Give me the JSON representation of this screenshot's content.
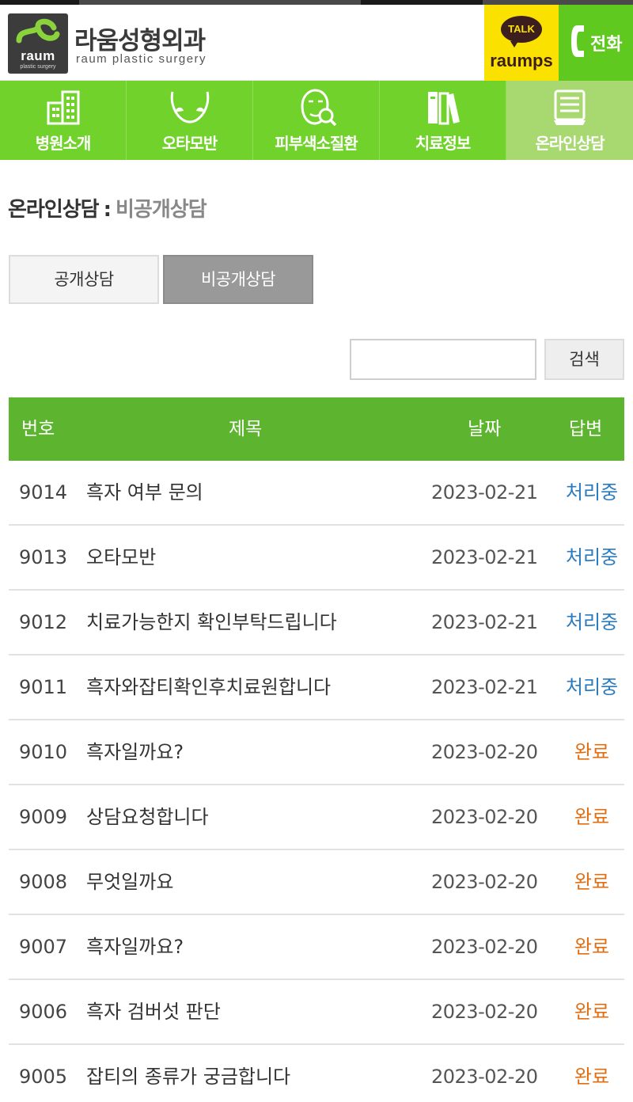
{
  "logo": {
    "mark_word": "raum",
    "mark_sub": "plastic surgery",
    "title_ko": "라움성형외과",
    "title_en": "raum plastic surgery"
  },
  "header_buttons": {
    "kakao_badge": "TALK",
    "kakao_label": "raumps",
    "phone_label": "전화"
  },
  "nav": [
    {
      "label": "병원소개",
      "icon": "building-icon"
    },
    {
      "label": "오타모반",
      "icon": "face-outline-icon"
    },
    {
      "label": "피부색소질환",
      "icon": "face-magnifier-icon"
    },
    {
      "label": "치료정보",
      "icon": "books-icon"
    },
    {
      "label": "온라인상담",
      "icon": "document-icon",
      "active": true
    }
  ],
  "page": {
    "title_main": "온라인상담",
    "title_sep": ":",
    "title_sub": "비공개상담"
  },
  "tabs": {
    "public": "공개상담",
    "private": "비공개상담"
  },
  "search": {
    "value": "",
    "button": "검색"
  },
  "table": {
    "headers": {
      "no": "번호",
      "title": "제목",
      "date": "날짜",
      "answer": "답변"
    },
    "rows": [
      {
        "no": "9014",
        "title": "흑자 여부 문의",
        "date": "2023-02-21",
        "status": "처리중"
      },
      {
        "no": "9013",
        "title": "오타모반",
        "date": "2023-02-21",
        "status": "처리중"
      },
      {
        "no": "9012",
        "title": "치료가능한지 확인부탁드립니다",
        "date": "2023-02-21",
        "status": "처리중"
      },
      {
        "no": "9011",
        "title": "흑자와잡티확인후치료원합니다",
        "date": "2023-02-21",
        "status": "처리중"
      },
      {
        "no": "9010",
        "title": "흑자일까요?",
        "date": "2023-02-20",
        "status": "완료"
      },
      {
        "no": "9009",
        "title": "상담요청합니다",
        "date": "2023-02-20",
        "status": "완료"
      },
      {
        "no": "9008",
        "title": "무엇일까요",
        "date": "2023-02-20",
        "status": "완료"
      },
      {
        "no": "9007",
        "title": "흑자일까요?",
        "date": "2023-02-20",
        "status": "완료"
      },
      {
        "no": "9006",
        "title": "흑자 검버섯 판단",
        "date": "2023-02-20",
        "status": "완료"
      },
      {
        "no": "9005",
        "title": "잡티의 종류가 궁금합니다",
        "date": "2023-02-20",
        "status": "완료"
      }
    ]
  },
  "colors": {
    "nav_green": "#71d22b",
    "header_green": "#5cb42f",
    "kakao_yellow": "#fae100",
    "status_processing": "#2a7bbf",
    "status_done": "#e06e12"
  }
}
